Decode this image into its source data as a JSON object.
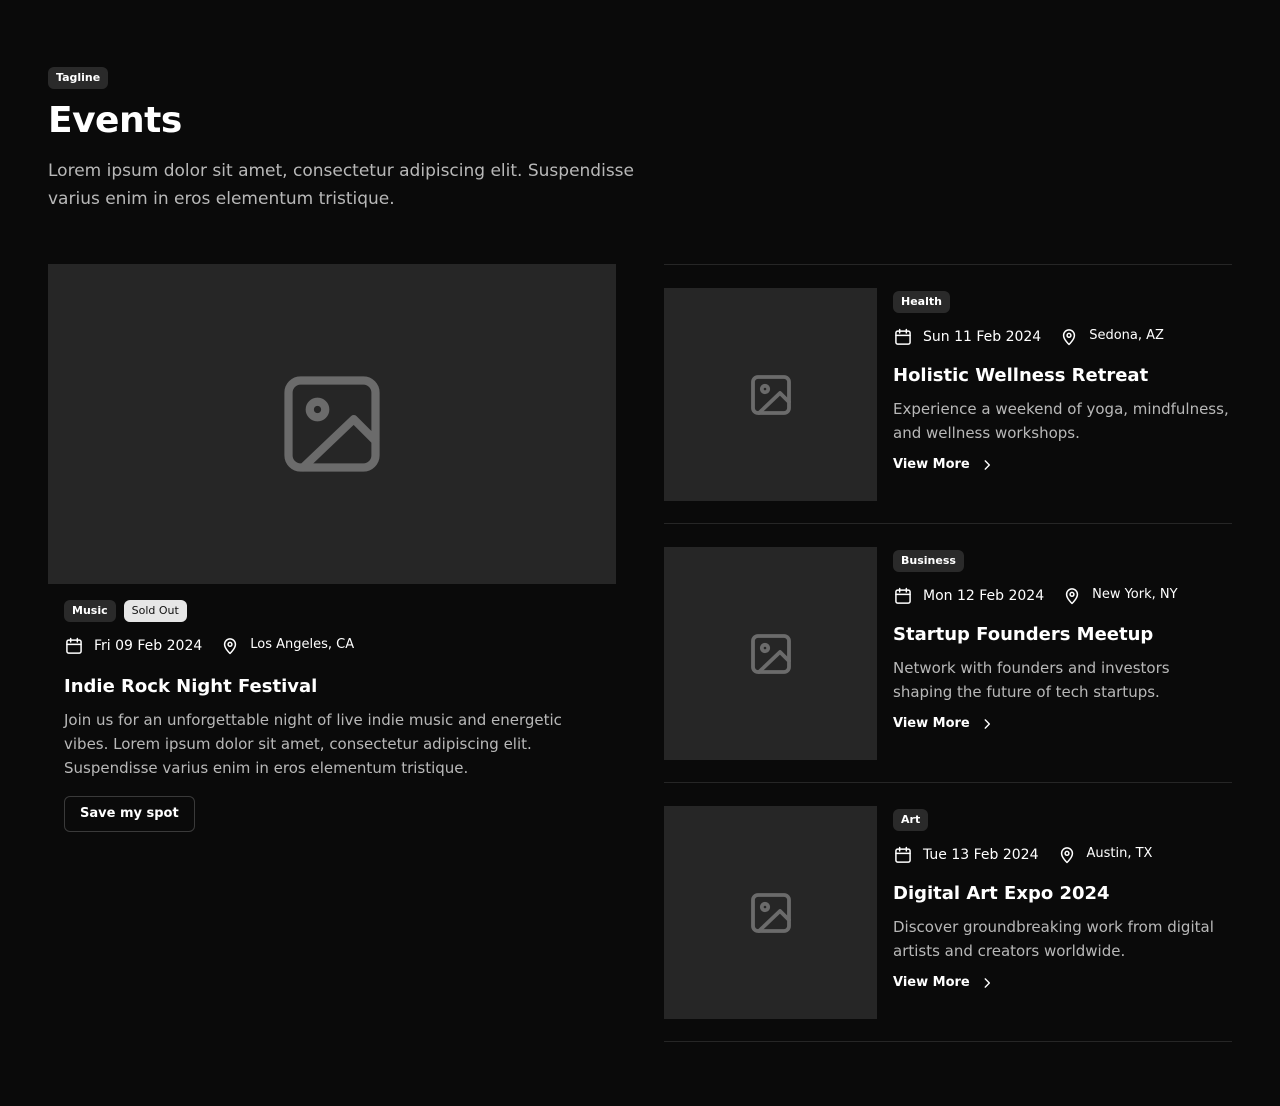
{
  "header": {
    "tagline": "Tagline",
    "title": "Events",
    "description": "Lorem ipsum dolor sit amet, consectetur adipiscing elit. Suspendisse varius enim in eros elementum tristique."
  },
  "featured": {
    "tags": [
      "Music",
      "Sold Out"
    ],
    "date": "Fri 09 Feb 2024",
    "location": "Los Angeles, CA",
    "title": "Indie Rock Night Festival",
    "description": "Join us for an unforgettable night of live indie music and energetic vibes. Lorem ipsum dolor sit amet, consectetur adipiscing elit. Suspendisse varius enim in eros elementum tristique.",
    "button_label": "Save my spot"
  },
  "events": [
    {
      "tag": "Health",
      "date": "Sun 11 Feb 2024",
      "location": "Sedona, AZ",
      "title": "Holistic Wellness Retreat",
      "description": "Experience a weekend of yoga, mindfulness, and wellness workshops.",
      "link_label": "View More"
    },
    {
      "tag": "Business",
      "date": "Mon 12 Feb 2024",
      "location": "New York, NY",
      "title": "Startup Founders Meetup",
      "description": "Network with founders and investors shaping the future of tech startups.",
      "link_label": "View More"
    },
    {
      "tag": "Art",
      "date": "Tue 13 Feb 2024",
      "location": "Austin, TX",
      "title": "Digital Art Expo 2024",
      "description": "Discover groundbreaking work from digital artists and creators worldwide.",
      "link_label": "View More"
    }
  ],
  "icons": {
    "image": "image-placeholder-icon",
    "calendar": "calendar-icon",
    "location": "map-pin-icon",
    "chevron": "chevron-right-icon"
  },
  "colors": {
    "background": "#0a0a0a",
    "placeholder": "#262626",
    "tag": "#2a2a2a",
    "muted_text": "#b8b8b8"
  }
}
